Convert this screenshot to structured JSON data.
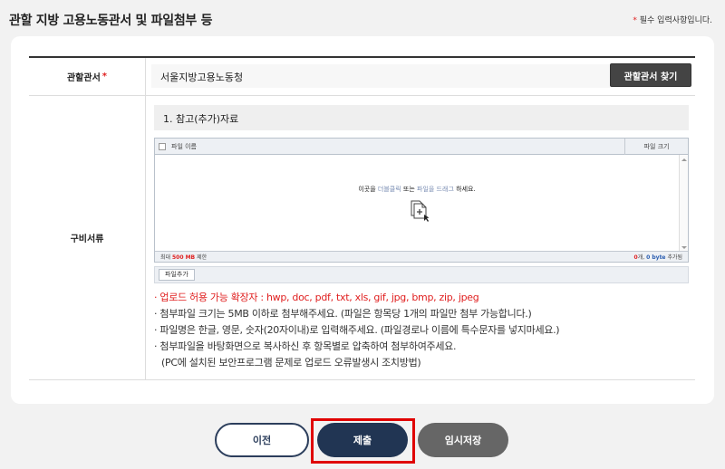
{
  "header": {
    "title": "관할 지방 고용노동관서 및 파일첨부 등",
    "required_star": "*",
    "required_note": "필수 입력사항입니다."
  },
  "office_row": {
    "label": "관할관서",
    "star": "*",
    "value": "서울지방고용노동청",
    "find_button": "관할관서 찾기"
  },
  "docs_row": {
    "label": "구비서류",
    "section_title": "1. 참고(추가)자료",
    "uploader": {
      "col_name": "파일 이름",
      "col_size": "파일 크기",
      "drop_prefix": "이곳을",
      "drop_dblclick": "더블클릭",
      "drop_mid": "또는",
      "drop_drag": "파일을 드래그",
      "drop_suffix": "하세요.",
      "footer_max_prefix": "최대",
      "footer_max_value": "500 MB",
      "footer_max_suffix": "제한",
      "footer_count": "0",
      "footer_count_unit": "개,",
      "footer_bytes": "0 byte",
      "footer_added": "추가됨"
    },
    "add_file_button": "파일추가",
    "notes": {
      "ext_line": "· 업로드 허용 가능 확장자 : hwp, doc, pdf, txt, xls, gif, jpg, bmp, zip, jpeg",
      "size_line": "· 첨부파일 크기는 5MB 이하로 첨부해주세요. (파일은 항목당 1개의 파일만 첨부 가능합니다.)",
      "name_line": "· 파일명은 한글, 영문, 숫자(20자이내)로 입력해주세요. (파일경로나 이름에 특수문자를 넣지마세요.)",
      "desktop_line": "· 첨부파일을 바탕화면으로 복사하신 후 항목별로 압축하여 첨부하여주세요.",
      "pc_line": "(PC에 설치된 보안프로그램 문제로 업로드 오류발생시 조치방법)"
    }
  },
  "buttons": {
    "prev": "이전",
    "submit": "제출",
    "temp_save": "임시저장"
  },
  "colors": {
    "accent": "#213553",
    "required": "#e02020",
    "highlight": "#e00000"
  }
}
